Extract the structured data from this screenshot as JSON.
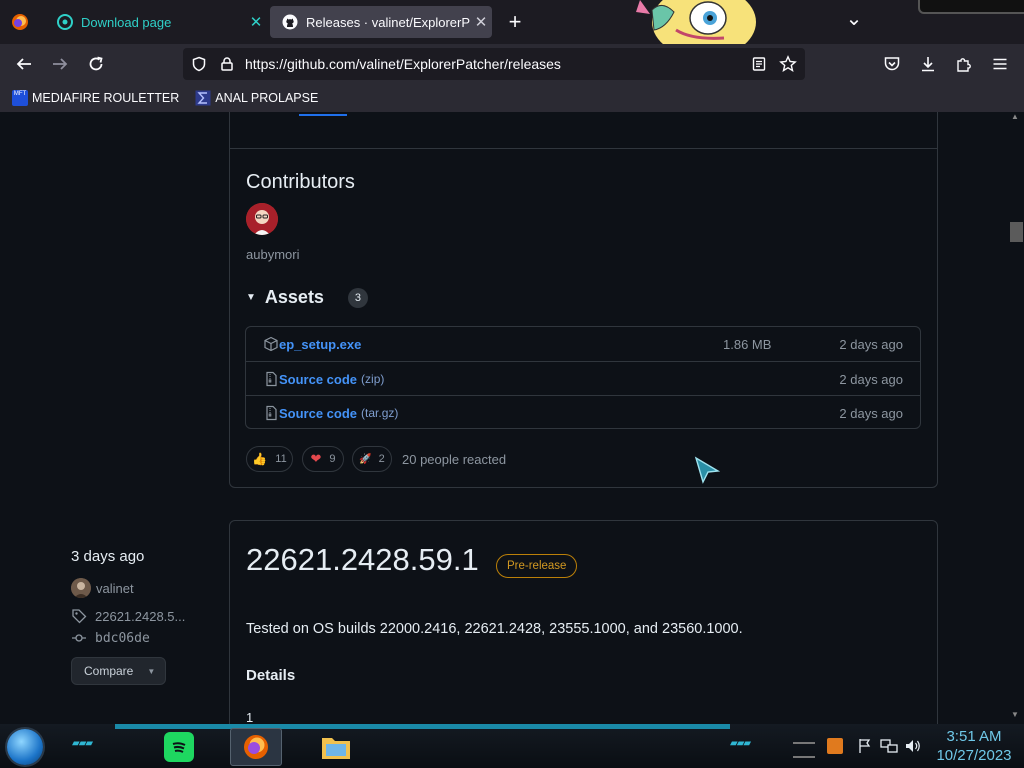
{
  "browser": {
    "tabs": [
      {
        "label": "Download page",
        "close": "✕"
      },
      {
        "label": "Releases · valinet/ExplorerPatcher",
        "close": "✕"
      }
    ],
    "new_tab": "+",
    "list_tabs": "⌄",
    "url": "https://github.com/valinet/ExplorerPatcher/releases"
  },
  "bookmarks": [
    {
      "label": "MEDIAFIRE ROULETTER",
      "icon_text": "MFT"
    },
    {
      "label": "ANAL PROLAPSE"
    }
  ],
  "release_prev": {
    "contributors_heading": "Contributors",
    "contributor": "aubymori",
    "assets_heading": "Assets",
    "assets_count": "3",
    "assets": [
      {
        "name": "ep_setup.exe",
        "suffix": "",
        "size": "1.86 MB",
        "date": "2 days ago"
      },
      {
        "name": "Source code",
        "suffix": "(zip)",
        "size": "",
        "date": "2 days ago"
      },
      {
        "name": "Source code",
        "suffix": "(tar.gz)",
        "size": "",
        "date": "2 days ago"
      }
    ],
    "reactions": [
      {
        "emoji": "👍",
        "count": "11"
      },
      {
        "emoji": "❤",
        "count": "9"
      },
      {
        "emoji": "🚀",
        "count": "2"
      }
    ],
    "reacted_text": "20 people reacted"
  },
  "release_next": {
    "time": "3 days ago",
    "author": "valinet",
    "tag": "22621.2428.5...",
    "commit": "bdc06de",
    "compare_label": "Compare",
    "title": "22621.2428.59.1",
    "badge": "Pre-release",
    "description": "Tested on OS builds 22000.2416, 22621.2428, 23555.1000, and 23560.1000.",
    "details_heading": "Details",
    "list_start": "1"
  },
  "taskbar": {
    "time": "3:51 AM",
    "date": "10/27/2023"
  },
  "colors": {
    "accent_link": "#4493f8",
    "prerelease": "#d29922",
    "tab_text_active": "#2fd0c8"
  }
}
